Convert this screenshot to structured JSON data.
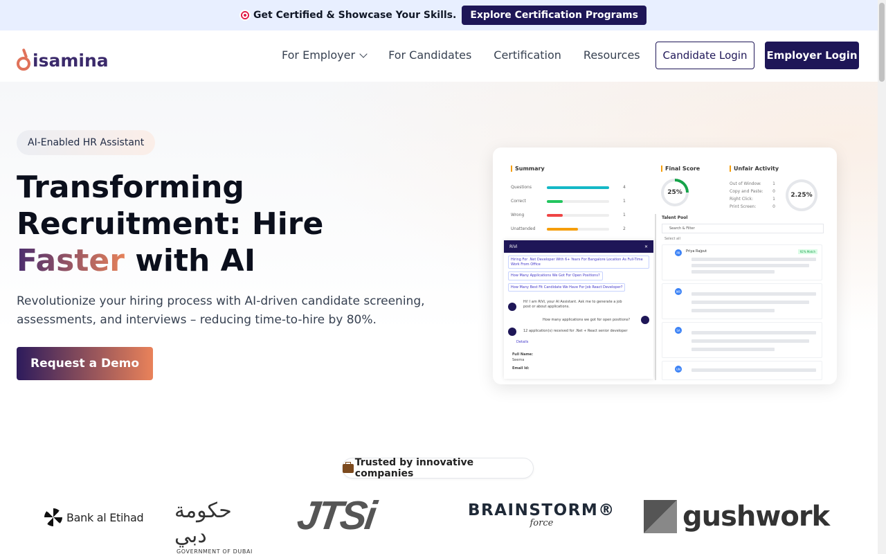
{
  "announcement": {
    "text": "Get Certified & Showcase Your Skills.",
    "cta": "Explore Certification Programs",
    "icon": "target-icon"
  },
  "nav": {
    "logo_text": "isamina",
    "links": [
      "For Employer",
      "For Candidates",
      "Certification",
      "Resources"
    ],
    "candidate_login": "Candidate Login",
    "employer_login": "Employer Login"
  },
  "hero": {
    "badge": "AI-Enabled HR Assistant",
    "title_part1": "Transforming Recruitment: Hire ",
    "title_highlight": "Faster",
    "title_part2": " with AI",
    "description": "Revolutionize your hiring process with AI-driven candidate screening, assessments, and interviews – reducing time-to-hire by 80%.",
    "cta": "Request a Demo"
  },
  "dashboard": {
    "summary_title": "Summary",
    "summary_rows": [
      {
        "label": "Questions",
        "value": "4",
        "fill": 1.0,
        "color": "#14b8c6"
      },
      {
        "label": "Correct",
        "value": "1",
        "fill": 0.25,
        "color": "#22c55e"
      },
      {
        "label": "Wrong",
        "value": "1",
        "fill": 0.25,
        "color": "#ef4444"
      },
      {
        "label": "Unattended",
        "value": "2",
        "fill": 0.5,
        "color": "#f59e0b"
      }
    ],
    "final_score_title": "Final Score",
    "final_score": "25%",
    "unfair_title": "Unfair Activity",
    "unfair_rows": [
      {
        "label": "Out of Window:",
        "value": "1"
      },
      {
        "label": "Copy and Paste:",
        "value": "0"
      },
      {
        "label": "Right Click:",
        "value": "1"
      },
      {
        "label": "Print Screen:",
        "value": "0"
      }
    ],
    "unfair_score": "2.25%",
    "chat_title": "RiVi",
    "chat_chips": [
      "Hiring For .Net Developer With 6+ Years For Bangalore Location As Full-Time Work From Office",
      "How Many Applications We Got For Open Positions?",
      "How Many Best Fit Candidate We Have For Job React Developer?"
    ],
    "chat_bot_msg": "Hi! I am RiVi, your AI Assistant. Ask me to generate a job post or about applications.",
    "chat_user_msg": "How many applications we got for open positions?",
    "chat_reply": "12 application(s) received for .Net + React senior developer",
    "chat_details": "Details",
    "chat_full_name_label": "Full Name:",
    "chat_full_name": "Seema",
    "chat_email_label": "Email Id:",
    "talent_title": "Talent Pool",
    "talent_search": "Search & Filter",
    "talent_select": "Select all",
    "talent_first_name": "Priya Rajput",
    "talent_match": "92% Match",
    "talent_avatars": [
      "PR",
      "MR",
      "SA",
      "UN"
    ]
  },
  "trusted": {
    "label": "Trusted by innovative companies",
    "icon": "briefcase-icon"
  },
  "clients": {
    "bank": "Bank al Etihad",
    "dubai_ar": "حكومة دبي",
    "dubai_en": "GOVERNMENT OF DUBAI",
    "jtsi": "JTSi",
    "brainstorm": "BRAINSTORM®",
    "brainstorm_sub": "force",
    "gushwork": "gushwork"
  }
}
